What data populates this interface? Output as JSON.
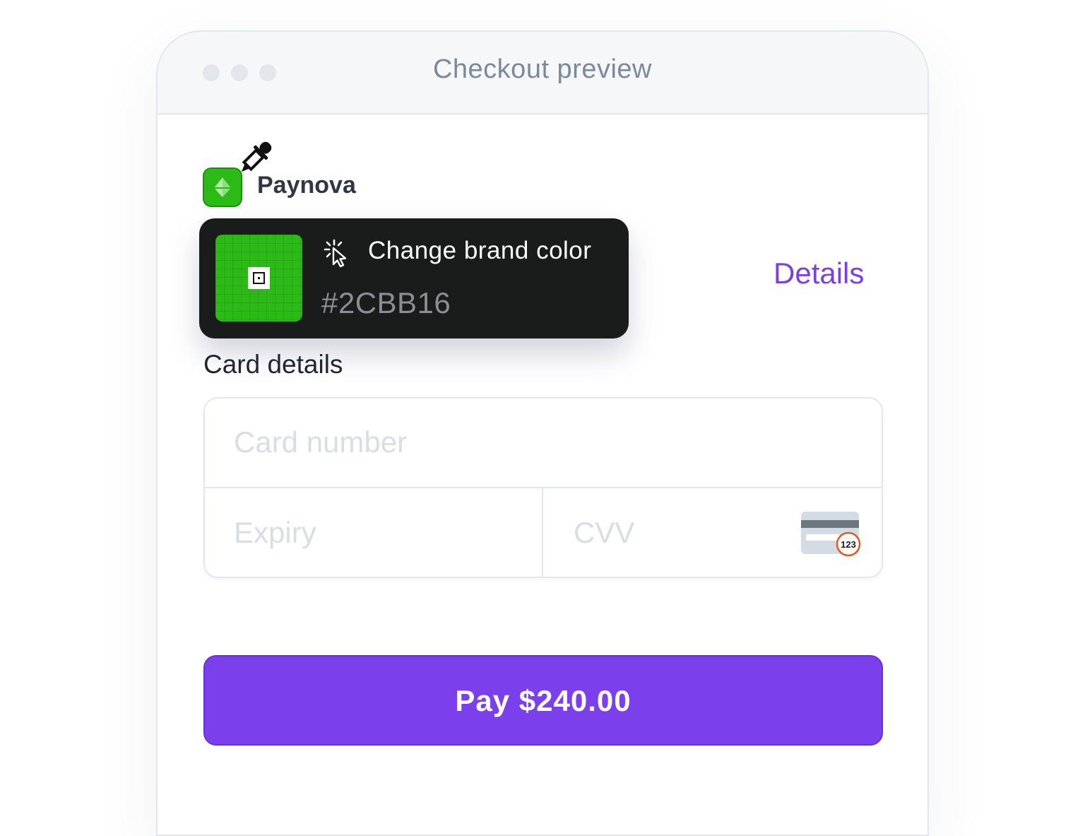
{
  "window": {
    "title": "Checkout preview"
  },
  "brand": {
    "name": "Paynova",
    "color": "#2CBB16"
  },
  "header": {
    "details_link": "Details"
  },
  "popover": {
    "title": "Change brand color",
    "hex_value": "#2CBB16"
  },
  "card": {
    "label": "Card details",
    "number_placeholder": "Card number",
    "expiry_placeholder": "Expiry",
    "cvv_placeholder": "CVV",
    "cvv_badge": "123"
  },
  "pay": {
    "label": "Pay $240.00",
    "color": "#7B3FEC"
  }
}
